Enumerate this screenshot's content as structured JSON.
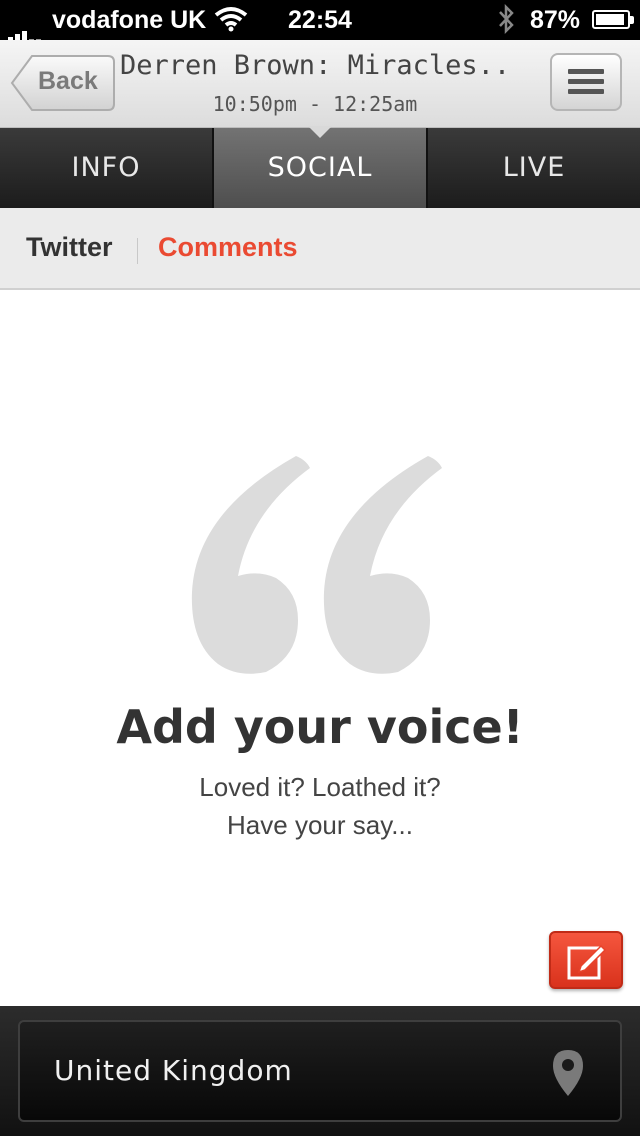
{
  "status_bar": {
    "carrier": "vodafone UK",
    "time": "22:54",
    "battery_percent": "87%",
    "battery_level": 0.87,
    "icons": [
      "signal-icon",
      "wifi-icon",
      "bluetooth-icon",
      "battery-icon"
    ]
  },
  "nav": {
    "back_label": "Back",
    "title": "Derren Brown: Miracles...",
    "subtitle": "10:50pm - 12:25am",
    "menu_icon": "menu-icon"
  },
  "tabs": [
    {
      "label": "INFO",
      "active": false
    },
    {
      "label": "SOCIAL",
      "active": true
    },
    {
      "label": "LIVE",
      "active": false
    }
  ],
  "subtabs": {
    "twitter": "Twitter",
    "comments": "Comments",
    "active": "comments"
  },
  "empty_state": {
    "icon": "quote-icon",
    "title": "Add your voice!",
    "line1": "Loved it? Loathed it?",
    "line2": "Have your say..."
  },
  "compose": {
    "icon": "compose-icon"
  },
  "location": {
    "label": "United Kingdom",
    "icon": "location-pin-icon"
  },
  "colors": {
    "accent": "#ea4a32",
    "compose": "#e8432b",
    "tab_active": "#5e5e5e",
    "tab_bar": "#2a2a2a"
  }
}
